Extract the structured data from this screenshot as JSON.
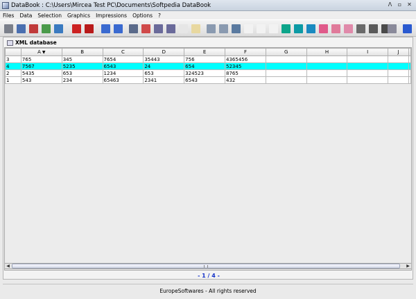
{
  "window": {
    "title": "DataBook : C:\\Users\\Mircea Test PC\\Documents\\Softpedia DataBook",
    "controls": [
      "ⴷ",
      "▫",
      "✕"
    ]
  },
  "menu": [
    "Files",
    "Data",
    "Selection",
    "Graphics",
    "Impressions",
    "Options",
    "?"
  ],
  "toolbar": [
    {
      "name": "print-icon",
      "color": "#7a7f8a"
    },
    {
      "name": "disk-icon",
      "color": "#4a6fb0"
    },
    {
      "name": "cut-icon",
      "color": "#c03a3a"
    },
    {
      "name": "copy-icon",
      "color": "#4a9a4a"
    },
    {
      "name": "paste-icon",
      "color": "#3a7ac0"
    },
    {
      "name": "book-red-icon",
      "color": "#cc2222"
    },
    {
      "name": "book-red-2-icon",
      "color": "#b81a1a"
    },
    {
      "name": "arrow-left-icon",
      "color": "#3a6ad0"
    },
    {
      "name": "arrow-right-icon",
      "color": "#3a6ad0"
    },
    {
      "name": "link-icon",
      "color": "#5a6a8a"
    },
    {
      "name": "unlink-icon",
      "color": "#d04a4a"
    },
    {
      "name": "tools-icon",
      "color": "#6a6a9a"
    },
    {
      "name": "tools-2-icon",
      "color": "#6a6a9a"
    },
    {
      "name": "page-icon",
      "color": "#e6e6e6"
    },
    {
      "name": "edit-page-icon",
      "color": "#e8d8a0"
    },
    {
      "name": "stack-icon",
      "color": "#8a9ab0"
    },
    {
      "name": "stack-2-icon",
      "color": "#8a9ab0"
    },
    {
      "name": "search-icon",
      "color": "#5a7aa0"
    },
    {
      "name": "chart-faint-1-icon",
      "color": "#f2f2f2"
    },
    {
      "name": "chart-faint-2-icon",
      "color": "#f2f2f2"
    },
    {
      "name": "chart-faint-3-icon",
      "color": "#f2f2f2"
    },
    {
      "name": "pie-chart-icon",
      "color": "#0ca58a"
    },
    {
      "name": "pie-chart-2-icon",
      "color": "#0c9aa5"
    },
    {
      "name": "pie-chart-3-icon",
      "color": "#1a8ac0"
    },
    {
      "name": "area-chart-icon",
      "color": "#e05a8a"
    },
    {
      "name": "area-chart-2-icon",
      "color": "#e07a9a"
    },
    {
      "name": "area-chart-3-icon",
      "color": "#e08aaa"
    },
    {
      "name": "bar-chart-icon",
      "color": "#6a6a6a"
    },
    {
      "name": "bar-chart-2-icon",
      "color": "#5a5a5a"
    },
    {
      "name": "bar-chart-3-icon",
      "color": "#4a4a4a"
    },
    {
      "name": "printer-icon",
      "color": "#8a8a9a"
    },
    {
      "name": "help-icon",
      "color": "#2a5ad0"
    }
  ],
  "document": {
    "title": "XML database"
  },
  "grid": {
    "columns": [
      "A",
      "B",
      "C",
      "D",
      "E",
      "F",
      "G",
      "H",
      "I",
      "J"
    ],
    "sorted_column": "A",
    "rows": [
      {
        "num": "3",
        "cells": [
          "765",
          "345",
          "7654",
          "35443",
          "756",
          "4365456",
          "",
          "",
          "",
          ""
        ],
        "selected": false
      },
      {
        "num": "4",
        "cells": [
          "7567",
          "5235",
          "6543",
          "24",
          "654",
          "52345",
          "",
          "",
          "",
          ""
        ],
        "selected": true
      },
      {
        "num": "2",
        "cells": [
          "5435",
          "653",
          "1234",
          "653",
          "324523",
          "8765",
          "",
          "",
          "",
          ""
        ],
        "selected": false
      },
      {
        "num": "1",
        "cells": [
          "543",
          "234",
          "65463",
          "2341",
          "6543",
          "432",
          "",
          "",
          "",
          ""
        ],
        "selected": false
      }
    ],
    "selected_color": "#00ffff"
  },
  "pager": {
    "text": "- 1 / 4 -"
  },
  "footer": {
    "text": "EuropeSoftwares - All rights reserved"
  }
}
